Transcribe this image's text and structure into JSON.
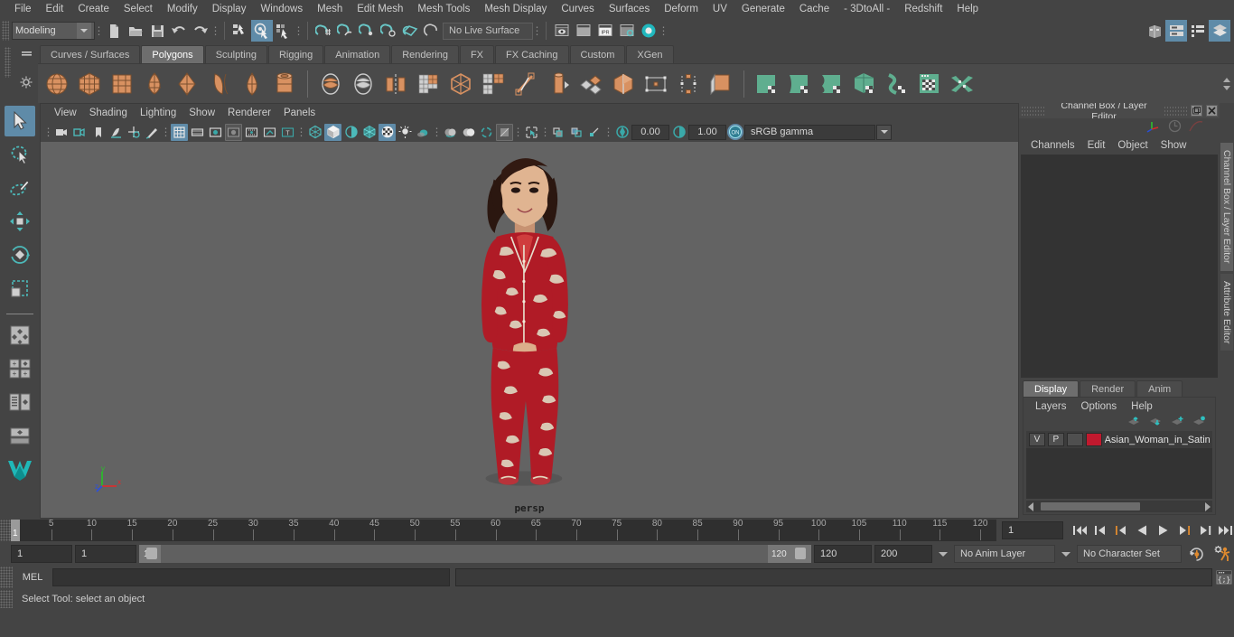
{
  "menubar": {
    "items": [
      "File",
      "Edit",
      "Create",
      "Select",
      "Modify",
      "Display",
      "Windows",
      "Mesh",
      "Edit Mesh",
      "Mesh Tools",
      "Mesh Display",
      "Curves",
      "Surfaces",
      "Deform",
      "UV",
      "Generate",
      "Cache",
      "- 3DtoAll -",
      "Redshift",
      "Help"
    ]
  },
  "statusline": {
    "menu_set": "Modeling",
    "live_surface": "No Live Surface",
    "icons": [
      "new-scene-icon",
      "open-scene-icon",
      "save-scene-icon",
      "undo-icon",
      "redo-icon",
      "select-by-hierarchy-icon",
      "select-by-object-icon",
      "select-by-component-icon",
      "snap-to-grid-icon",
      "snap-to-curve-icon",
      "snap-to-point-icon",
      "snap-to-projected-center-icon",
      "snap-to-view-plane-icon",
      "make-live-icon",
      "render-current-frame-icon",
      "render-sequence-icon",
      "ipr-render-icon",
      "render-settings-icon",
      "hypershade-icon",
      "show-hide-editors-icon",
      "attribute-editor-toggle-icon",
      "tool-settings-toggle-icon",
      "channel-box-toggle-icon"
    ]
  },
  "shelf": {
    "tabs": [
      "Curves / Surfaces",
      "Polygons",
      "Sculpting",
      "Rigging",
      "Animation",
      "Rendering",
      "FX",
      "FX Caching",
      "Custom",
      "XGen"
    ],
    "active_tab": "Polygons",
    "icons": [
      "poly-sphere-icon",
      "poly-cube-icon",
      "poly-cylinder-icon",
      "poly-cone-icon",
      "poly-torus-icon",
      "poly-plane-icon",
      "poly-disc-icon",
      "poly-pipe-icon",
      "poly-boolean-union-icon",
      "poly-boolean-difference-icon",
      "poly-mirror-icon",
      "poly-combine-icon",
      "poly-smooth-icon",
      "poly-multicut-icon",
      "poly-bevel-icon",
      "poly-extrude-icon",
      "poly-bridge-icon",
      "poly-wedge-icon",
      "poly-target-weld-icon",
      "poly-symmetrize-icon",
      "poly-quad-draw-icon",
      "sculpt-plane-icon",
      "sculpt-surface-icon",
      "sculpt-mesh-icon",
      "sculpt-cube-icon",
      "sculpt-curve-icon",
      "sculpt-window-icon",
      "sculpt-cross-icon"
    ]
  },
  "toolbox": {
    "tools": [
      "select-tool",
      "lasso-select-tool",
      "paint-select-tool",
      "move-tool",
      "rotate-tool",
      "scale-tool",
      "last-tool-used",
      "four-view-layout",
      "single-perspective-layout",
      "outliner-persp-layout",
      "hypershade-persp-layout",
      "persp-graph-layout",
      "maya-logo-icon"
    ],
    "selected": "select-tool"
  },
  "viewport": {
    "menus": [
      "View",
      "Shading",
      "Lighting",
      "Show",
      "Renderer",
      "Panels"
    ],
    "camera_label": "persp",
    "exposure": "0.00",
    "gamma": "1.00",
    "color_space": "sRGB gamma",
    "gamma_toggle": "ON",
    "axis": {
      "x": "x",
      "y": "y",
      "z": "z"
    },
    "scene_object": "Asian Woman in Satin Pajamas",
    "toolbar_icons": [
      "select-camera-icon",
      "camera-attributes-icon",
      "bookmark-icon",
      "image-plane-icon",
      "two-d-pan-zoom-icon",
      "grease-pencil-icon",
      "grid-toggle-icon",
      "film-gate-icon",
      "resolution-gate-icon",
      "gate-mask-icon",
      "film-origin-icon",
      "safe-action-icon",
      "safe-title-icon",
      "wireframe-icon",
      "smooth-shade-all-icon",
      "shade-selected-icon",
      "wireframe-on-shaded-icon",
      "texture-toggle-icon",
      "use-default-lighting-icon",
      "shadows-icon",
      "screen-space-ao-icon",
      "motion-blur-icon",
      "multisample-aa-icon",
      "depth-of-field-icon",
      "isolate-select-icon"
    ]
  },
  "channel_box": {
    "title": "Channel Box / Layer Editor",
    "menus": [
      "Channels",
      "Edit",
      "Object",
      "Show"
    ],
    "window_buttons": [
      "undock-icon",
      "close-icon"
    ],
    "header_icons": [
      "axis-display-icon",
      "clock-icon",
      "anim-curve-icon"
    ]
  },
  "layer_editor": {
    "tabs": [
      "Display",
      "Render",
      "Anim"
    ],
    "active_tab": "Display",
    "menus": [
      "Layers",
      "Options",
      "Help"
    ],
    "icons": [
      "move-layer-up-icon",
      "move-layer-down-icon",
      "new-layer-icon",
      "new-layer-from-selected-icon"
    ],
    "layers": [
      {
        "visible": "V",
        "playback": "P",
        "shading": "",
        "color": "#c1192e",
        "name": "Asian_Woman_in_Satin"
      }
    ]
  },
  "dock_tabs": [
    "Channel Box / Layer Editor",
    "Attribute Editor"
  ],
  "timeline": {
    "tick_labels": [
      5,
      10,
      15,
      20,
      25,
      30,
      35,
      40,
      45,
      50,
      55,
      60,
      65,
      70,
      75,
      80,
      85,
      90,
      95,
      100,
      105,
      110,
      115,
      120
    ],
    "current_frame_marker": "1",
    "current_frame_field": "1",
    "playback_buttons": [
      "go-to-start-icon",
      "step-back-keyframe-icon",
      "step-back-frame-icon",
      "play-backwards-icon",
      "play-forwards-icon",
      "step-forward-frame-icon",
      "step-forward-keyframe-icon",
      "go-to-end-icon"
    ]
  },
  "range_slider": {
    "start_time": "1",
    "playback_start": "1",
    "range_left_label": "1",
    "range_right_label": "120",
    "playback_end": "120",
    "end_time": "200",
    "anim_layer": "No Anim Layer",
    "character_set": "No Character Set",
    "auto_key_icon": "auto-keyframe-icon",
    "anim_prefs_icon": "animation-preferences-icon"
  },
  "command_line": {
    "label": "MEL",
    "input_value": "",
    "script_editor_icon": "script-editor-icon"
  },
  "help_line": {
    "text": "Select Tool: select an object"
  },
  "colors": {
    "accent_blue": "#5f8ba8",
    "shelf_orange": "#d89161",
    "shelf_green": "#5fae8f",
    "viewport_bg": "#636363",
    "panel_bg": "#444444",
    "dark_field": "#333333",
    "layer_red": "#c1192e"
  }
}
